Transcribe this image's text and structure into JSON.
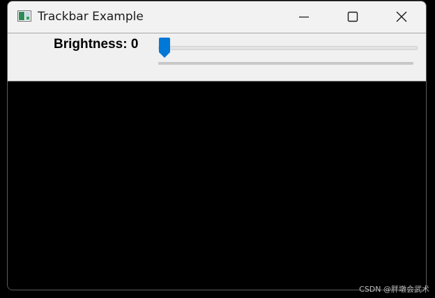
{
  "window": {
    "title": "Trackbar Example"
  },
  "titlebar": {
    "icon": "app-window-icon",
    "minimize_icon": "minimize-icon",
    "maximize_icon": "maximize-icon",
    "close_icon": "close-icon"
  },
  "trackbar": {
    "label": "Brightness: 0",
    "value": 0,
    "min": 0,
    "fill_fraction": 0.0,
    "accent_color": "#0078d7"
  },
  "watermark": {
    "text": "CSDN @胖墩会武术"
  },
  "colors": {
    "titlebar_bg": "#f2f2f2",
    "toolbar_bg": "#f0f0f0",
    "image_bg": "#000000"
  }
}
